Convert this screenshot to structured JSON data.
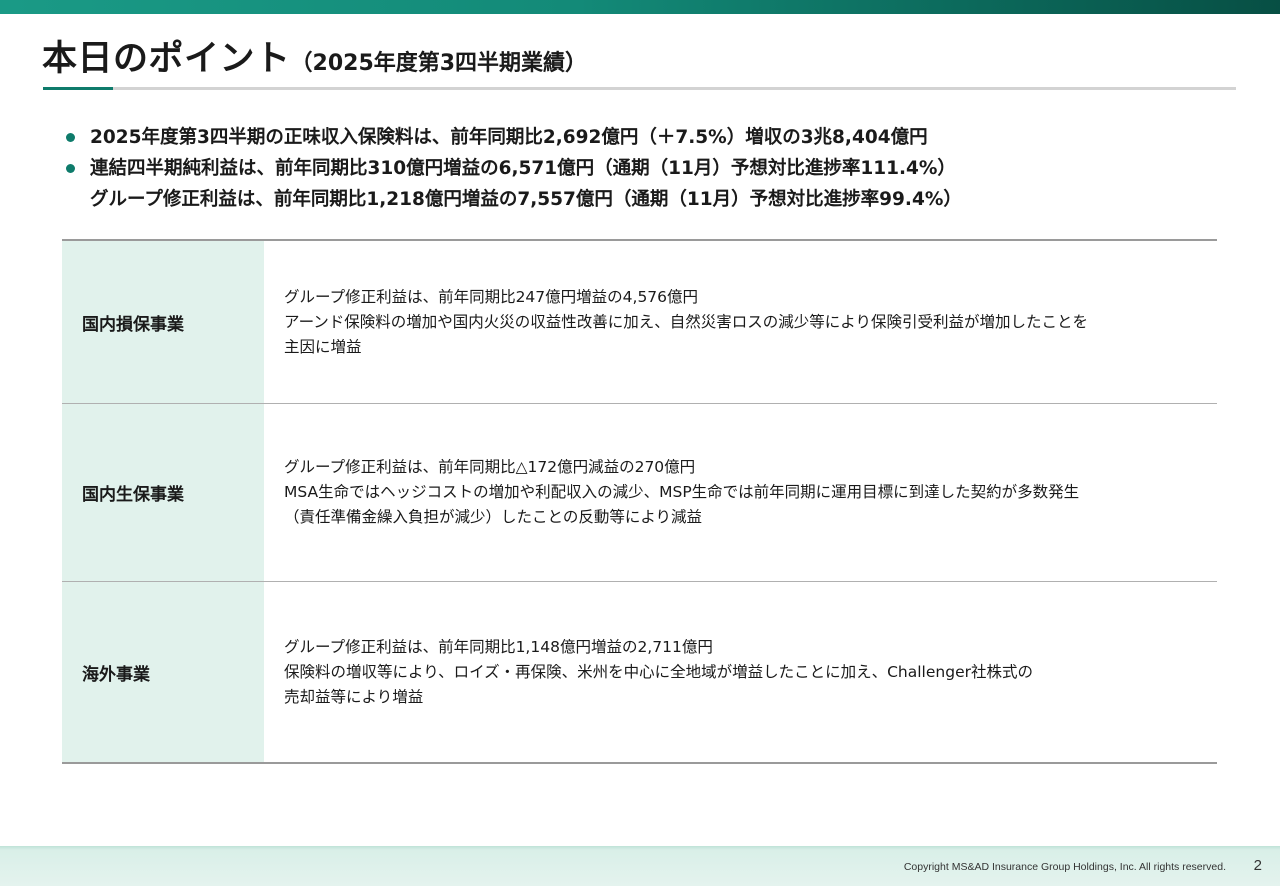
{
  "header": {
    "title": "本日のポイント",
    "subtitle": "（2025年度第3四半期業績）"
  },
  "bullets": [
    {
      "lines": [
        "2025年度第3四半期の正味収入保険料は、前年同期比2,692億円（＋7.5%）増収の3兆8,404億円"
      ]
    },
    {
      "lines": [
        "連結四半期純利益は、前年同期比310億円増益の6,571億円（通期（11月）予想対比進捗率111.4%）",
        "グループ修正利益は、前年同期比1,218億円増益の7,557億円（通期（11月）予想対比進捗率99.4%）"
      ]
    }
  ],
  "segments": [
    {
      "name": "国内損保事業",
      "lines": [
        "グループ修正利益は、前年同期比247億円増益の4,576億円",
        "アーンド保険料の増加や国内火災の収益性改善に加え、自然災害ロスの減少等により保険引受利益が増加したことを",
        "主因に増益"
      ]
    },
    {
      "name": "国内生保事業",
      "lines": [
        "グループ修正利益は、前年同期比△172億円減益の270億円",
        "MSA生命ではヘッジコストの増加や利配収入の減少、MSP生命では前年同期に運用目標に到達した契約が多数発生",
        "（責任準備金繰入負担が減少）したことの反動等により減益"
      ]
    },
    {
      "name": "海外事業",
      "lines": [
        "グループ修正利益は、前年同期比1,148億円増益の2,711億円",
        "保険料の増収等により、ロイズ・再保険、米州を中心に全地域が増益したことに加え、Challenger社株式の",
        "売却益等により増益"
      ]
    }
  ],
  "footer": {
    "copyright": "Copyright MS&AD Insurance Group Holdings, Inc. All rights reserved.",
    "page_number": "2"
  },
  "colors": {
    "accent": "#0e7b6b",
    "label_bg": "#e1f2ec"
  }
}
